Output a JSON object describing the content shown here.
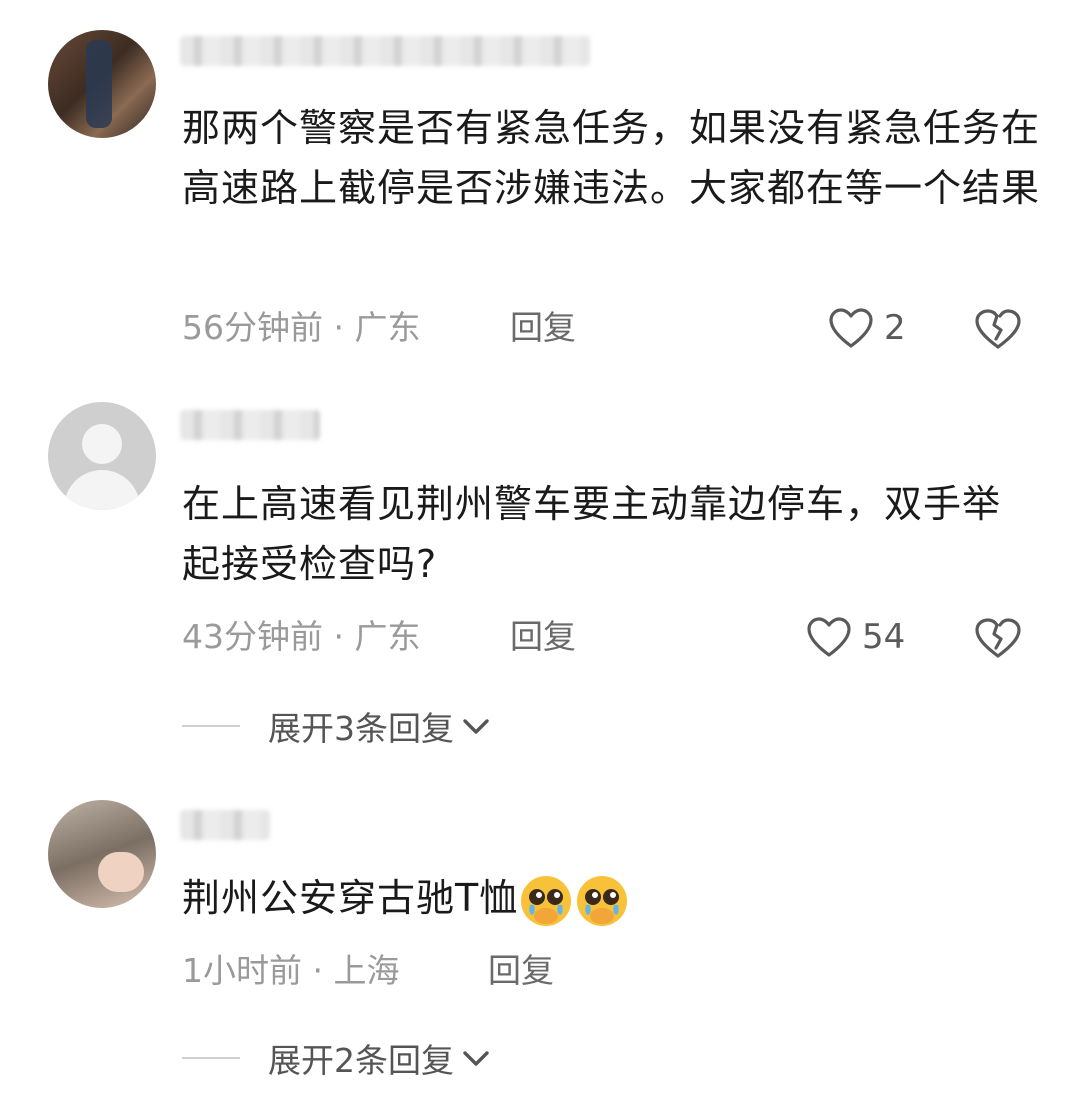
{
  "comments": [
    {
      "text": "那两个警察是否有紧急任务，如果没有紧急任务在高速路上截停是否涉嫌违法。大家都在等一个结果",
      "meta": "56分钟前 · 广东",
      "reply": "回复",
      "likes": "2",
      "avatar": "photo-avatar"
    },
    {
      "text": "在上高速看见荆州警车要主动靠边停车，双手举起接受检查吗?",
      "meta": "43分钟前 · 广东",
      "reply": "回复",
      "likes": "54",
      "avatar": "default-avatar",
      "expand": "展开3条回复"
    },
    {
      "text": "荆州公安穿古驰T恤",
      "emojis": [
        "crying-face-emoji",
        "crying-face-emoji"
      ],
      "meta": "1小时前 · 上海",
      "reply": "回复",
      "avatar": "photo-avatar",
      "expand": "展开2条回复"
    }
  ],
  "icons": {
    "like": "heart-outline-icon",
    "dislike": "broken-heart-icon",
    "expand": "chevron-down-icon"
  },
  "colors": {
    "meta": "#9a9a9a",
    "text": "#1a1a1a"
  }
}
